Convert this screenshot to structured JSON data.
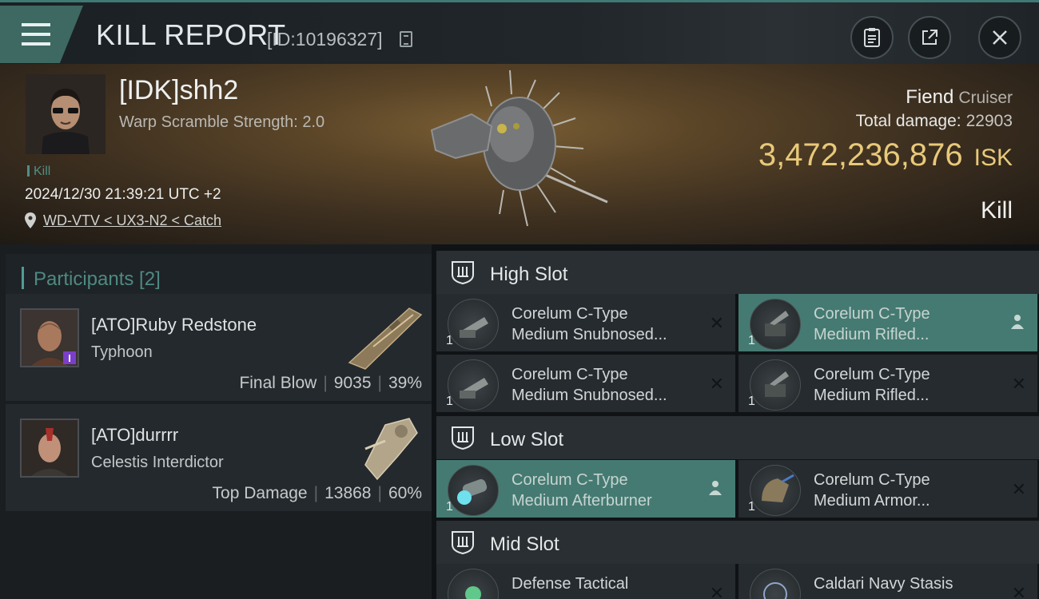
{
  "header": {
    "title": "KILL REPORT",
    "id_label": "[ID:10196327]",
    "menu_icon": "hamburger-icon",
    "clipboard_icon": "clipboard-icon",
    "share_icon": "share-icon",
    "close_icon": "close-icon"
  },
  "victim": {
    "name": "[IDK]shh2",
    "warp_scramble": "Warp Scramble Strength: 2.0",
    "kill_tag": "Kill",
    "datetime": "2024/12/30 21:39:21 UTC +2",
    "location": "WD-VTV < UX3-N2 < Catch",
    "ship": "Fiend",
    "ship_class": "Cruiser",
    "total_damage_label": "Total damage:",
    "total_damage": "22903",
    "isk_value": "3,472,236,876",
    "isk_unit": "ISK",
    "result": "Kill"
  },
  "participants": {
    "title": "Participants [2]",
    "list": [
      {
        "name": "[ATO]Ruby Redstone",
        "ship": "Typhoon",
        "role": "Final Blow",
        "damage": "9035",
        "percent": "39%"
      },
      {
        "name": "[ATO]durrrr",
        "ship": "Celestis Interdictor",
        "role": "Top Damage",
        "damage": "13868",
        "percent": "60%"
      }
    ]
  },
  "slots": {
    "high": {
      "label": "High Slot",
      "modules": [
        {
          "line1": "Corelum C-Type",
          "line2": "Medium Snubnosed...",
          "qty": "1"
        },
        {
          "line1": "Corelum C-Type",
          "line2": "Medium Rifled...",
          "qty": "1"
        },
        {
          "line1": "Corelum C-Type",
          "line2": "Medium Snubnosed...",
          "qty": "1"
        },
        {
          "line1": "Corelum C-Type",
          "line2": "Medium Rifled...",
          "qty": "1"
        }
      ]
    },
    "low": {
      "label": "Low Slot",
      "modules": [
        {
          "line1": "Corelum C-Type",
          "line2": "Medium Afterburner",
          "qty": "1"
        },
        {
          "line1": "Corelum C-Type",
          "line2": "Medium Armor...",
          "qty": "1"
        }
      ]
    },
    "mid": {
      "label": "Mid Slot",
      "modules": [
        {
          "line1": "Defense Tactical",
          "line2": "",
          "qty": ""
        },
        {
          "line1": "Caldari Navy Stasis",
          "line2": "",
          "qty": ""
        }
      ]
    }
  },
  "colors": {
    "accent": "#457a72",
    "isk": "#e8c97a",
    "panel": "#24292d"
  }
}
